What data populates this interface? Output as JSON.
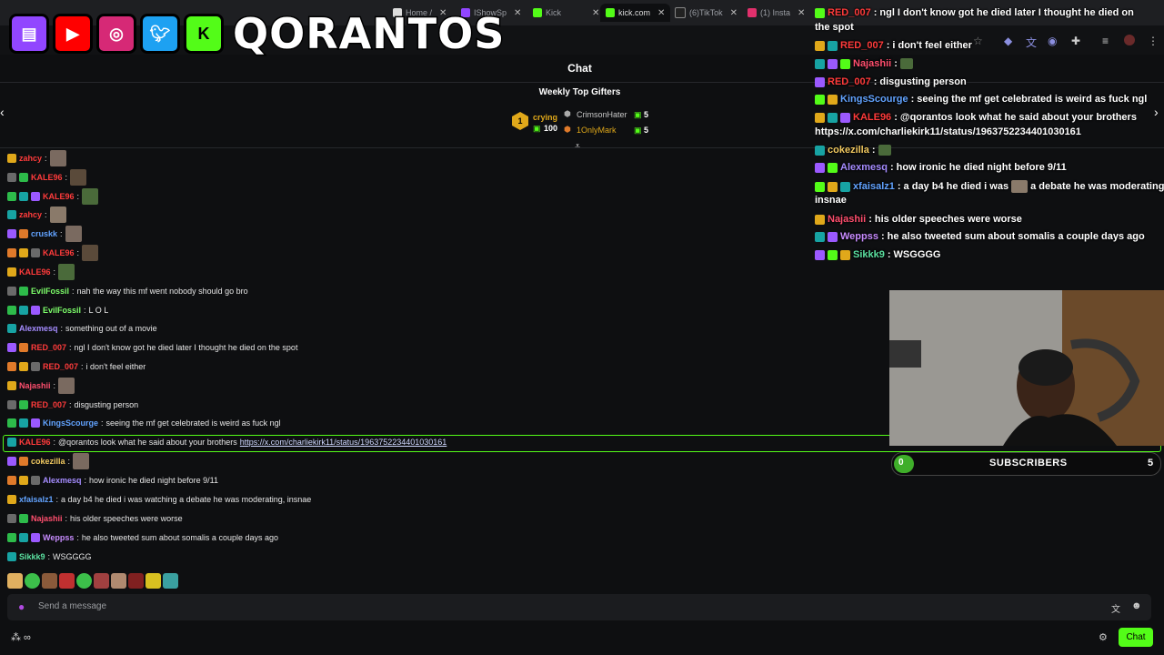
{
  "browser": {
    "tabs": [
      {
        "label": "Home /",
        "icon": "x-icon"
      },
      {
        "label": "IShowSp",
        "icon": "twitch-icon"
      },
      {
        "label": "Kick",
        "icon": "kick-icon"
      },
      {
        "label": "kick.com",
        "icon": "kick-icon"
      },
      {
        "label": "(6)TikTok",
        "icon": "tiktok-icon"
      },
      {
        "label": "(1) Insta",
        "icon": "instagram-icon"
      }
    ]
  },
  "overlay": {
    "brand": "QORANTOS",
    "socials": [
      "twitch-icon",
      "youtube-icon",
      "instagram-icon",
      "twitter-icon",
      "kick-icon"
    ],
    "chat": [
      {
        "user": "RED_007",
        "color": "#ff3b3b",
        "text": "ngl I don't know got he died later I thought he died on",
        "cont": "the spot"
      },
      {
        "user": "RED_007",
        "color": "#ff3b3b",
        "text": "i don't feel either"
      },
      {
        "user": "Najashii",
        "color": "#ff4f6e",
        "text": ""
      },
      {
        "user": "RED_007",
        "color": "#ff3b3b",
        "text": "disgusting person"
      },
      {
        "user": "KingsScourge",
        "color": "#62a3ff",
        "text": "seeing the mf get celebrated is weird as fuck ngl"
      },
      {
        "user": "KALE96",
        "color": "#ff3b3b",
        "text": "@qorantos look what he said about your brothers",
        "cont": "https://x.com/charliekirk11/status/1963752234401030161"
      },
      {
        "user": "cokezilla",
        "color": "#f0c860",
        "text": ""
      },
      {
        "user": "Alexmesq",
        "color": "#a58cff",
        "text": "how ironic he died night before 9/11"
      },
      {
        "user": "xfaisalz1",
        "color": "#62a3ff",
        "text": "a day b4 he died i was",
        "after": "a debate he was moderating,",
        "cont": "insnae"
      },
      {
        "user": "Najashii",
        "color": "#ff4f6e",
        "text": "his older speeches were worse"
      },
      {
        "user": "Weppss",
        "color": "#c88cff",
        "text": "he also tweeted sum about somalis a couple days ago"
      },
      {
        "user": "Sikkk9",
        "color": "#5be0a0",
        "text": "WSGGGG"
      }
    ],
    "subscribers": {
      "label": "SUBSCRIBERS",
      "current": "0",
      "goal": "5",
      "progress": 0
    }
  },
  "chat": {
    "title": "Chat",
    "gifters_title": "Weekly Top Gifters",
    "top_gifter": {
      "rank": "1",
      "name": "crying",
      "count": "100"
    },
    "gifters": [
      {
        "name": "CrimsonHater",
        "count": "5"
      },
      {
        "name": "1OnlyMark",
        "count": "5"
      }
    ],
    "messages": [
      {
        "user": "zahcy",
        "color": "#ff3b3b",
        "text": "",
        "emote": true
      },
      {
        "user": "KALE96",
        "color": "#ff3b3b",
        "text": "",
        "emote": true
      },
      {
        "user": "KALE96",
        "color": "#ff3b3b",
        "text": "",
        "emote": true
      },
      {
        "user": "zahcy",
        "color": "#ff3b3b",
        "text": "",
        "emote": true
      },
      {
        "user": "cruskk",
        "color": "#62a3ff",
        "text": "",
        "emote": true
      },
      {
        "user": "KALE96",
        "color": "#ff3b3b",
        "text": "",
        "emote": true
      },
      {
        "user": "KALE96",
        "color": "#ff3b3b",
        "text": "",
        "emote": true
      },
      {
        "user": "EvilFossil",
        "color": "#7dff6a",
        "text": "nah the way this mf went nobody should go bro"
      },
      {
        "user": "EvilFossil",
        "color": "#7dff6a",
        "text": "L O L"
      },
      {
        "user": "Alexmesq",
        "color": "#a58cff",
        "text": "something out of a movie"
      },
      {
        "user": "RED_007",
        "color": "#ff3b3b",
        "text": "ngl I don't know got he died later I thought he died on the spot"
      },
      {
        "user": "RED_007",
        "color": "#ff3b3b",
        "text": "i don't feel either"
      },
      {
        "user": "Najashii",
        "color": "#ff4f6e",
        "text": "",
        "emote": true
      },
      {
        "user": "RED_007",
        "color": "#ff3b3b",
        "text": "disgusting person"
      },
      {
        "user": "KingsScourge",
        "color": "#62a3ff",
        "text": "seeing the mf get celebrated is weird as fuck ngl"
      },
      {
        "user": "KALE96",
        "color": "#ff3b3b",
        "text": "@qorantos look what he said about your brothers",
        "link": "https://x.com/charliekirk11/status/1963752234401030161"
      },
      {
        "user": "cokezilla",
        "color": "#f0c860",
        "text": "",
        "emote": true
      },
      {
        "user": "Alexmesq",
        "color": "#a58cff",
        "text": "how ironic he died night before 9/11"
      },
      {
        "user": "xfaisalz1",
        "color": "#62a3ff",
        "text": "a day b4 he died i was watching a debate he was moderating, insnae"
      },
      {
        "user": "Najashii",
        "color": "#ff4f6e",
        "text": "his older speeches were worse"
      },
      {
        "user": "Weppss",
        "color": "#c88cff",
        "text": "he also tweeted sum about somalis a couple days ago"
      },
      {
        "user": "Sikkk9",
        "color": "#5be0a0",
        "text": "WSGGGG"
      }
    ],
    "input_placeholder": "Send a message",
    "send_label": "Chat",
    "colors": {
      "accent": "#53fc18"
    }
  }
}
